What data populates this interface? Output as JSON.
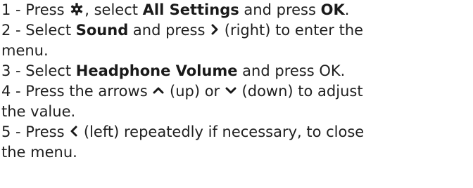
{
  "steps": [
    {
      "line1": {
        "a": "1 -  Press ",
        "icon": "settings-gear-icon",
        "b": ", select ",
        "bold1": "All Settings",
        "c": " and press ",
        "bold2": "OK",
        "d": "."
      }
    },
    {
      "line1": {
        "a": "2 -  Select ",
        "bold1": "Sound",
        "b": " and press ",
        "icon": "chevron-right-icon",
        "c": " (right) to enter the"
      },
      "line2": "menu."
    },
    {
      "line1": {
        "a": "3 -  Select ",
        "bold1": "Headphone Volume",
        "b": " and press OK."
      }
    },
    {
      "line1": {
        "a": "4 -  Press the arrows ",
        "icon1": "chevron-up-icon",
        "b": " (up) or ",
        "icon2": "chevron-down-icon",
        "c": " (down) to adjust"
      },
      "line2": "the value."
    },
    {
      "line1": {
        "a": "5 -  Press ",
        "icon": "chevron-left-icon",
        "b": " (left) repeatedly if necessary, to close"
      },
      "line2": "the menu."
    }
  ]
}
